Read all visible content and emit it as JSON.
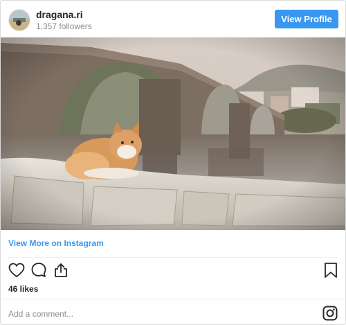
{
  "header": {
    "username": "dragana.ri",
    "followers": "1,357 followers",
    "view_profile_label": "View Profile"
  },
  "post": {
    "image_description_icon": "photo",
    "view_more_label": "View More on Instagram",
    "likes": "46 likes",
    "comment_placeholder": "Add a comment..."
  },
  "actions": {
    "like_icon": "heart-icon",
    "comment_icon": "comment-icon",
    "share_icon": "share-icon",
    "save_icon": "bookmark-icon",
    "instagram_icon": "instagram-icon"
  },
  "colors": {
    "accent": "#3897f0",
    "muted": "#8e8e8e",
    "text": "#262626"
  }
}
